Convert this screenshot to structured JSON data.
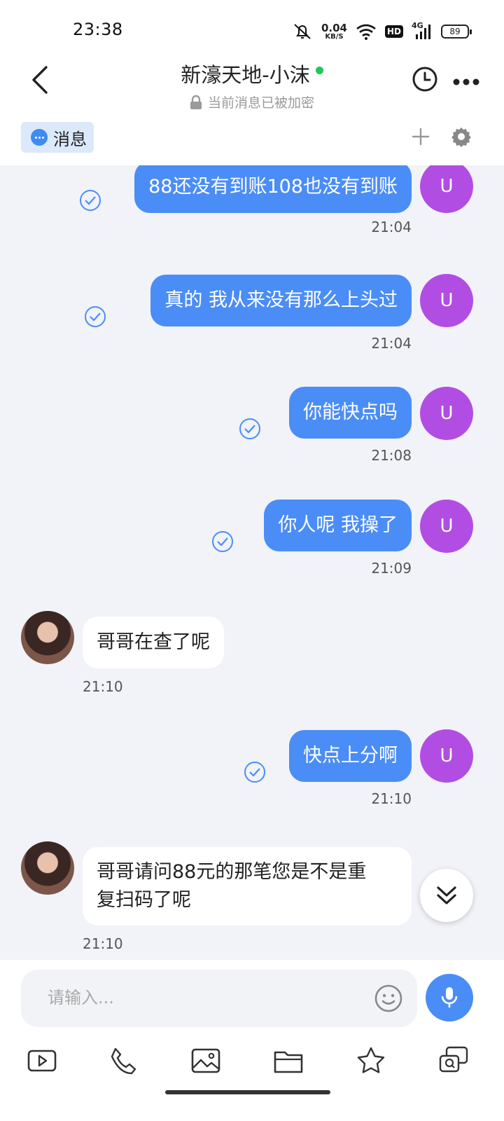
{
  "status_bar": {
    "time": "23:38",
    "net_speed_value": "0.04",
    "net_speed_unit": "KB/S",
    "hd_badge": "HD",
    "network": "4G",
    "battery": "89"
  },
  "header": {
    "title": "新濠天地-小沫",
    "subtitle": "当前消息已被加密",
    "online_color": "#1dc85a"
  },
  "tabs": {
    "messages_label": "消息"
  },
  "theme": {
    "outgoing_bubble": "#4b8df6",
    "user_avatar": "#b24de3",
    "accent": "#4b8df6"
  },
  "messages": [
    {
      "direction": "out",
      "text": "88还没有到账108也没有到账",
      "time": "21:04",
      "avatar_letter": "U",
      "status": "read-check-icon"
    },
    {
      "direction": "out",
      "text": "真的 我从来没有那么上头过",
      "time": "21:04",
      "avatar_letter": "U",
      "status": "read-check-icon"
    },
    {
      "direction": "out",
      "text": "你能快点吗",
      "time": "21:08",
      "avatar_letter": "U",
      "status": "read-check-icon"
    },
    {
      "direction": "out",
      "text": "你人呢 我操了",
      "time": "21:09",
      "avatar_letter": "U",
      "status": "read-check-icon"
    },
    {
      "direction": "in",
      "text": "哥哥在查了呢",
      "time": "21:10"
    },
    {
      "direction": "out",
      "text": "快点上分啊",
      "time": "21:10",
      "avatar_letter": "U",
      "status": "read-check-icon"
    },
    {
      "direction": "in",
      "text": "哥哥请问88元的那笔您是不是重复扫码了呢",
      "line1": "哥哥请问88元的那笔您是不是重",
      "line2": "复扫码了呢",
      "time": "21:10"
    }
  ],
  "input": {
    "placeholder": "请输入..."
  },
  "toolbar_icons": [
    "video-icon",
    "phone-icon",
    "image-icon",
    "folder-icon",
    "star-icon",
    "question-chat-icon"
  ]
}
